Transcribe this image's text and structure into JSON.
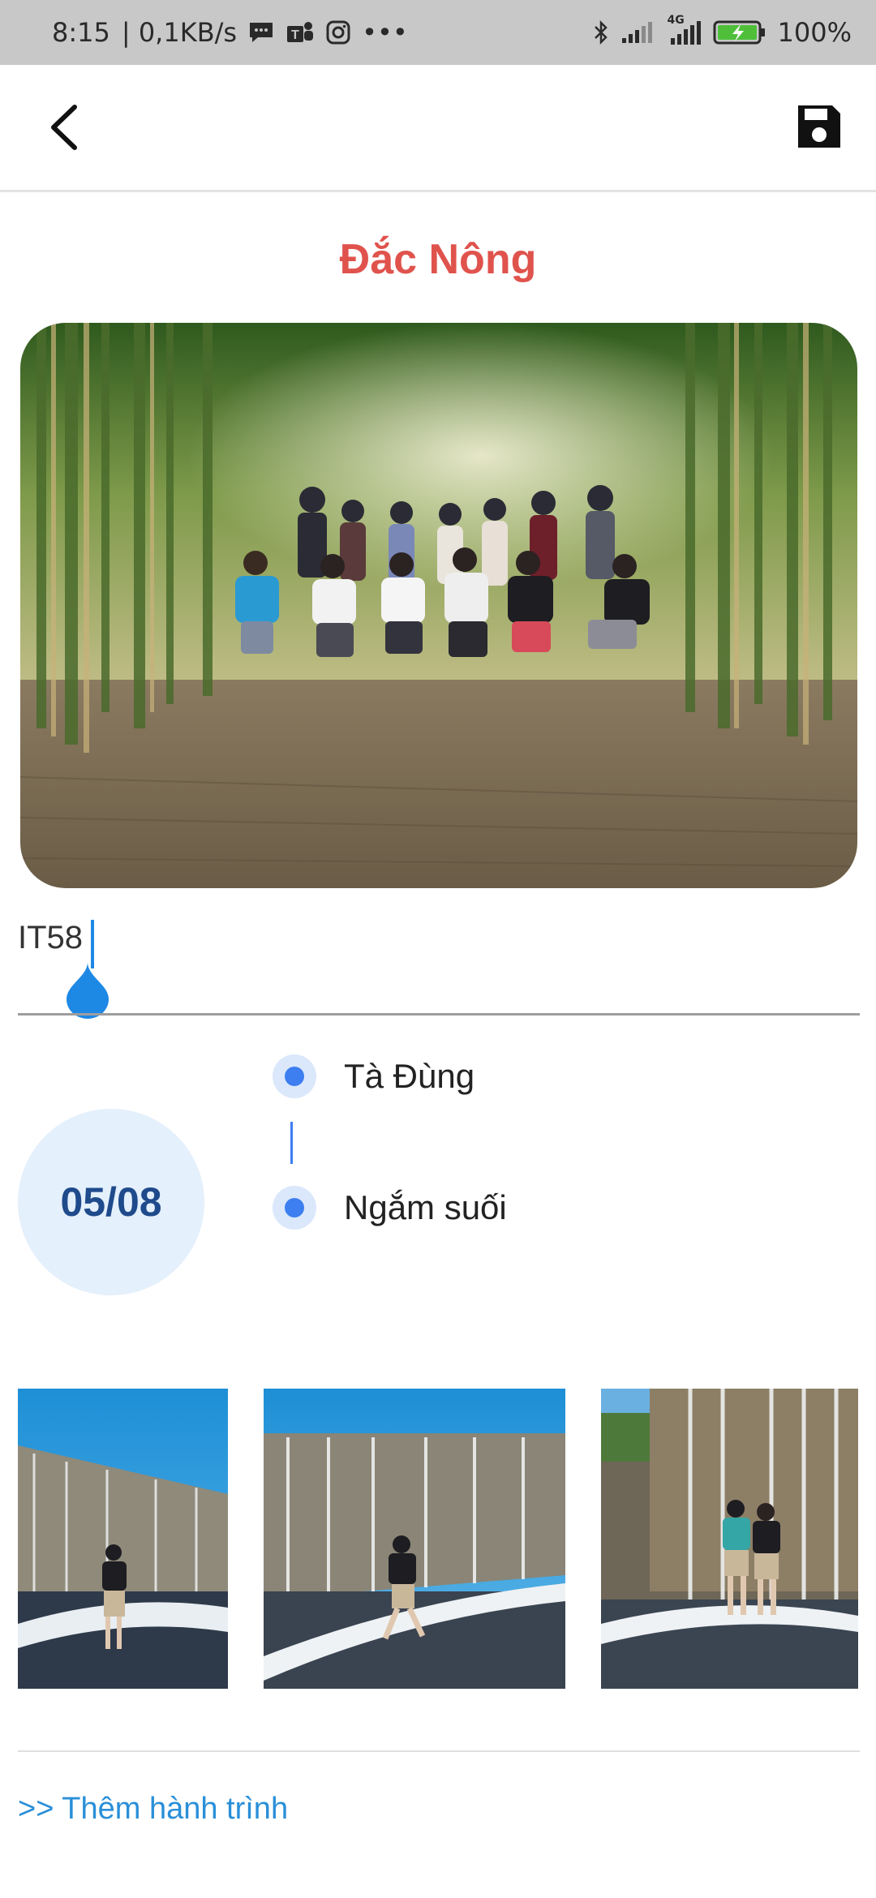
{
  "status_bar": {
    "time": "8:15",
    "speed": "| 0,1KB/s",
    "more": "•••",
    "network_type": "4G",
    "battery": "100%",
    "icons": [
      "message-icon",
      "teams-icon",
      "instagram-icon",
      "bluetooth-icon",
      "signal-icon",
      "signal-4g-icon",
      "battery-charging-icon"
    ]
  },
  "app_bar": {
    "back_icon": "back-chevron-icon",
    "save_icon": "save-icon"
  },
  "place": {
    "title": "Đắc Nông"
  },
  "caption_input": {
    "value": "IT58"
  },
  "trip": {
    "date": "05/08",
    "stops": [
      "Tà Đùng",
      "Ngắm suối"
    ]
  },
  "photos": {
    "hero": "group-photo-bamboo-forest",
    "thumbnails": [
      "waterfall-photo-1",
      "waterfall-photo-2",
      "waterfall-photo-3"
    ]
  },
  "actions": {
    "add_trip": ">> Thêm hành trình"
  },
  "colors": {
    "title": "#e0534d",
    "accent": "#3d7ef0",
    "date_bg": "#e4f0fc",
    "date_text": "#1f4b8c",
    "link": "#2a8fd8"
  }
}
